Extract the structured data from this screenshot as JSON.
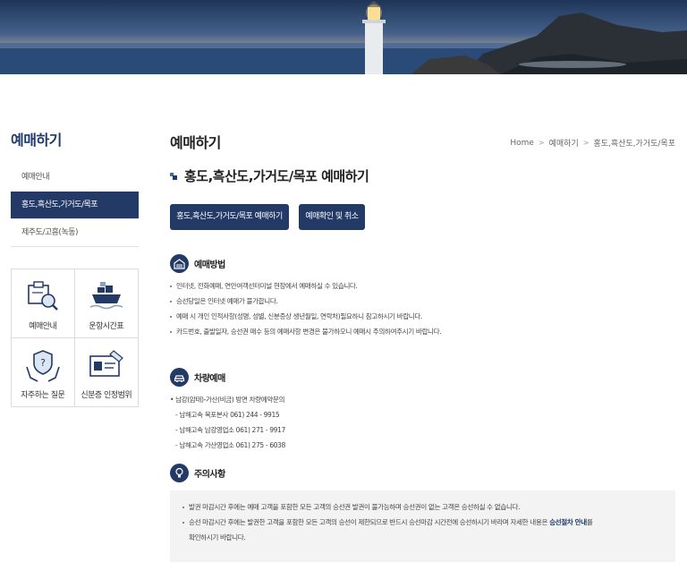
{
  "sidebar": {
    "title": "예매하기",
    "items": [
      {
        "label": "예매안내"
      },
      {
        "label": "홍도,흑산도,가거도/목포"
      },
      {
        "label": "제주도/고흥(녹동)"
      }
    ],
    "quick_links": [
      {
        "label": "예매안내",
        "icon": "search-document-icon"
      },
      {
        "label": "운항시간표",
        "icon": "ship-icon"
      },
      {
        "label": "자주하는 질문",
        "icon": "faq-hands-icon"
      },
      {
        "label": "신분증 인정범위",
        "icon": "id-card-icon"
      }
    ]
  },
  "main": {
    "page_title": "예매하기",
    "breadcrumb": [
      "Home",
      "예매하기",
      "홍도,흑산도,가거도/목포"
    ],
    "sub_title": "홍도,흑산도,가거도/목포 예매하기",
    "buttons": {
      "book": "홍도,흑산도,가거도/목포 예매하기",
      "check": "예매확인 및 취소"
    },
    "method": {
      "title": "예매방법",
      "items": [
        "인터넷, 전화예매, 연안여객선터미널 현장에서 예매하실 수 있습니다.",
        "승선당일은 인터넷 예매가 불가합니다.",
        "예매 시 개인 인적사항(성명, 성별, 신분증상 생년월일, 연락처)필요하니 참고하시기 바랍니다.",
        "카드번호, 출발일자, 승선권 매수 등의 예매사항 변경은 불가하오니 예매시 주의하여주시기 바랍니다."
      ]
    },
    "vehicle": {
      "title": "차량예매",
      "lines": [
        "• 남강(암태)-가산(비금) 방면 차량예약문의",
        "- 남해고속 목포본사 061) 244 - 9915",
        "- 남해고속 남강영업소 061) 271 - 9917",
        "- 남해고속 가산영업소 061) 275 - 6038"
      ]
    },
    "caution": {
      "title": "주의사항",
      "item1": "발권 마감시간 후에는 예매 고객을 포함한 모든 고객의 승선권 발권이 불가능하며 승선권이 없는 고객은 승선하실 수 없습니다.",
      "item2_a": "승선 마감시간 후에는 발권한 고객을 포함한 모든 고객의 승선이 제한되므로 반드시 승선마감 시간전에 승선하시기 바라며 자세한 내용은 ",
      "item2_link": "승선절차 안내",
      "item2_b": "를",
      "item2_c": "확인하시기 바랍니다."
    }
  },
  "colors": {
    "navy": "#233a66",
    "title_blue": "#1e3a6a"
  }
}
